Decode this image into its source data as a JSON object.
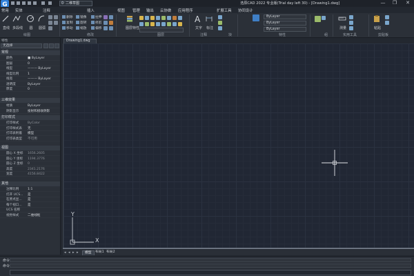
{
  "titlebar": {
    "app_logo": "G",
    "workspace": "二维草图",
    "title": "浩辰CAD 2022 专业版(Trial day left 30) - [Drawing1.dwg]",
    "window_buttons": [
      "—",
      "❐",
      "✕"
    ]
  },
  "menu": {
    "items": [
      "常用",
      "实体",
      "注释",
      "插入",
      "视图",
      "管理",
      "输出",
      "云协做",
      "应用程序",
      "扩展工具",
      "协同设计"
    ]
  },
  "ribbon": {
    "draw_group": {
      "label": "绘图",
      "tools": [
        "直线",
        "多段线",
        "圆",
        "圆弧"
      ]
    },
    "modify_group": {
      "label": "修改",
      "rows": [
        "删除",
        "复制",
        "镜像",
        "移动",
        "旋转",
        "缩放",
        "拉伸",
        "修剪",
        "偏移"
      ]
    },
    "layer_group": {
      "label": "图层"
    },
    "block_group": {
      "label": "块",
      "tool": "图层特性"
    },
    "annotation_group": {
      "label": "注释",
      "text_tool": "文字",
      "dim_tool": "标注"
    },
    "properties_group": {
      "label": "特性",
      "color": "ByLayer",
      "linetype": "ByLayer",
      "lineweight": "ByLayer"
    },
    "group_group": {
      "label": "组"
    },
    "utilities_group": {
      "label": "实用工具",
      "tools": [
        "测量",
        "粘贴"
      ]
    },
    "clipboard_group": {
      "label": "剪贴板"
    }
  },
  "properties": {
    "title": "特性",
    "selection": "无选择",
    "sections": [
      {
        "title": "常规",
        "rows": [
          {
            "key": "颜色",
            "value": "■ ByLayer"
          },
          {
            "key": "图层",
            "value": "0"
          },
          {
            "key": "线型",
            "value": "——— ByLayer"
          },
          {
            "key": "线型比例",
            "value": "1"
          },
          {
            "key": "线宽",
            "value": "——— ByLayer"
          },
          {
            "key": "透明度",
            "value": "ByLayer"
          },
          {
            "key": "厚度",
            "value": "0"
          }
        ]
      },
      {
        "title": "三维效果",
        "rows": [
          {
            "key": "材质",
            "value": "ByLayer"
          },
          {
            "key": "阴影显示",
            "value": "投射和接收阴影"
          }
        ]
      },
      {
        "title": "打印样式",
        "rows": [
          {
            "key": "打印样式",
            "value": "ByColor"
          },
          {
            "key": "打印样式表",
            "value": "无"
          },
          {
            "key": "打印表附着",
            "value": "模型"
          },
          {
            "key": "打印表类型",
            "value": "不可用"
          }
        ]
      },
      {
        "title": "视图",
        "rows": [
          {
            "key": "圆心 X 坐标",
            "value": "1656.2605"
          },
          {
            "key": "圆心 Y 坐标",
            "value": "1194.3776"
          },
          {
            "key": "圆心 Z 坐标",
            "value": "0"
          },
          {
            "key": "高度",
            "value": "2341.2176"
          },
          {
            "key": "宽度",
            "value": "4156.8422"
          }
        ]
      },
      {
        "title": "其他",
        "rows": [
          {
            "key": "注释比例",
            "value": "1:1"
          },
          {
            "key": "打开 UCS...",
            "value": "是"
          },
          {
            "key": "在原点显...",
            "value": "是"
          },
          {
            "key": "每个视口...",
            "value": "是"
          },
          {
            "key": "UCS 名称",
            "value": ""
          },
          {
            "key": "视觉样式",
            "value": "二维线框"
          }
        ]
      }
    ]
  },
  "document": {
    "tab": "Drawing1.dwg"
  },
  "canvas": {
    "ucs_y": "Y",
    "ucs_x": "X"
  },
  "layout_tabs": {
    "items": [
      "模型",
      "布局1",
      "布局2"
    ],
    "active": "模型",
    "nav": [
      "◂",
      "◂",
      "▸",
      "▸"
    ]
  },
  "command": {
    "history": [
      "命令:",
      "命令:"
    ],
    "prompt": ""
  },
  "colors": {
    "canvas": "#212734",
    "accent": "#2f7fd8",
    "panel": "#2b3038"
  }
}
